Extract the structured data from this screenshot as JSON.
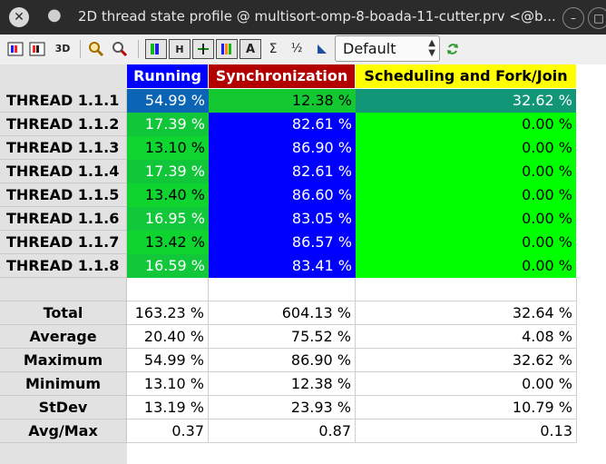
{
  "window": {
    "title": "2D thread state profile @ multisort-omp-8-boada-11-cutter.prv <@b...",
    "close_glyph": "✕",
    "dot_glyph": "●"
  },
  "toolbar": {
    "buttons": [
      "3D"
    ],
    "h_label": "H",
    "sigma": "Σ",
    "fraction": "½",
    "semantic_combo": "Default"
  },
  "table": {
    "columns": [
      {
        "label": "Running",
        "bg": "#0000ff",
        "color": "#ffffff"
      },
      {
        "label": "Synchronization",
        "bg": "#b30000",
        "color": "#ffffff"
      },
      {
        "label": "Scheduling and Fork/Join",
        "bg": "#ffff00",
        "color": "#000000"
      }
    ],
    "threads": [
      {
        "name": "THREAD 1.1.1",
        "values": [
          "54.99 %",
          "12.38 %",
          "32.62 %"
        ],
        "colors": [
          "#0c64b4",
          "#14c832",
          "#119678"
        ],
        "fg": [
          "#ffffff",
          "#000000",
          "#ffffff"
        ]
      },
      {
        "name": "THREAD 1.1.2",
        "values": [
          "17.39 %",
          "82.61 %",
          "0.00 %"
        ],
        "colors": [
          "#12c63a",
          "#0000ff",
          "#00ff00"
        ],
        "fg": [
          "#ffffff",
          "#ffffff",
          "#000000"
        ]
      },
      {
        "name": "THREAD 1.1.3",
        "values": [
          "13.10 %",
          "86.90 %",
          "0.00 %"
        ],
        "colors": [
          "#0fd530",
          "#0000ff",
          "#00ff00"
        ],
        "fg": [
          "#000000",
          "#ffffff",
          "#000000"
        ]
      },
      {
        "name": "THREAD 1.1.4",
        "values": [
          "17.39 %",
          "82.61 %",
          "0.00 %"
        ],
        "colors": [
          "#12c63a",
          "#0000ff",
          "#00ff00"
        ],
        "fg": [
          "#ffffff",
          "#ffffff",
          "#000000"
        ]
      },
      {
        "name": "THREAD 1.1.5",
        "values": [
          "13.40 %",
          "86.60 %",
          "0.00 %"
        ],
        "colors": [
          "#0fd430",
          "#0000ff",
          "#00ff00"
        ],
        "fg": [
          "#000000",
          "#ffffff",
          "#000000"
        ]
      },
      {
        "name": "THREAD 1.1.6",
        "values": [
          "16.95 %",
          "83.05 %",
          "0.00 %"
        ],
        "colors": [
          "#11c73a",
          "#0000ff",
          "#00ff00"
        ],
        "fg": [
          "#ffffff",
          "#ffffff",
          "#000000"
        ]
      },
      {
        "name": "THREAD 1.1.7",
        "values": [
          "13.42 %",
          "86.57 %",
          "0.00 %"
        ],
        "colors": [
          "#0fd430",
          "#0000ff",
          "#00ff00"
        ],
        "fg": [
          "#000000",
          "#ffffff",
          "#000000"
        ]
      },
      {
        "name": "THREAD 1.1.8",
        "values": [
          "16.59 %",
          "83.41 %",
          "0.00 %"
        ],
        "colors": [
          "#11c83a",
          "#0000ff",
          "#00ff00"
        ],
        "fg": [
          "#ffffff",
          "#ffffff",
          "#000000"
        ]
      }
    ],
    "stats": [
      {
        "name": "Total",
        "values": [
          "163.23 %",
          "604.13 %",
          "32.64 %"
        ]
      },
      {
        "name": "Average",
        "values": [
          "20.40 %",
          "75.52 %",
          "4.08 %"
        ]
      },
      {
        "name": "Maximum",
        "values": [
          "54.99 %",
          "86.90 %",
          "32.62 %"
        ]
      },
      {
        "name": "Minimum",
        "values": [
          "13.10 %",
          "12.38 %",
          "0.00 %"
        ]
      },
      {
        "name": "StDev",
        "values": [
          "13.19 %",
          "23.93 %",
          "10.79 %"
        ]
      },
      {
        "name": "Avg/Max",
        "values": [
          "0.37",
          "0.87",
          "0.13"
        ]
      }
    ]
  }
}
